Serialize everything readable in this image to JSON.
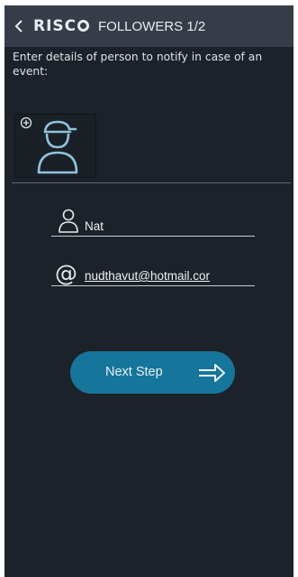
{
  "header": {
    "brand": "RISCO",
    "brand_letters": "RISC",
    "title": "FOLLOWERS 1/2"
  },
  "intro_text": "Enter details of person to notify in case of an event:",
  "icons": {
    "back": "chevron-left-icon",
    "add_photo": "add-circle-icon",
    "avatar": "person-with-cap-icon",
    "name_field": "person-icon",
    "email_field": "at-sign-icon",
    "next": "arrow-right-icon"
  },
  "form": {
    "name_value": "Nat",
    "email_symbol": "@",
    "email_value": "nudthavut@hotmail.cor"
  },
  "actions": {
    "next_label": "Next Step"
  },
  "colors": {
    "background": "#1c2229",
    "topbar": "#363d48",
    "accent_button": "#16759a",
    "avatar_line": "#8fc3df"
  }
}
